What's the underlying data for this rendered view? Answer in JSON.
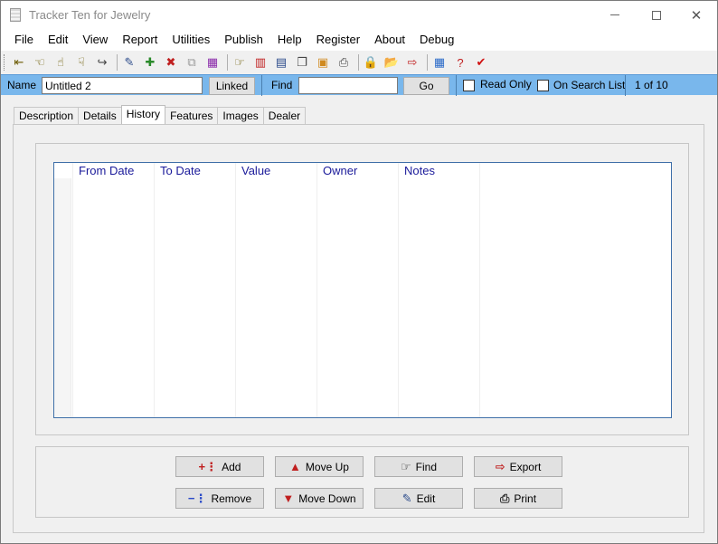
{
  "window": {
    "title": "Tracker Ten for Jewelry"
  },
  "menu": [
    "File",
    "Edit",
    "View",
    "Report",
    "Utilities",
    "Publish",
    "Help",
    "Register",
    "About",
    "Debug"
  ],
  "toolbar_icons": [
    {
      "name": "first-record-icon",
      "glyph": "⇤",
      "color": "#6b5a00"
    },
    {
      "name": "previous-record-icon",
      "glyph": "☜",
      "color": "#6b5a00"
    },
    {
      "name": "next-record-icon",
      "glyph": "☝",
      "color": "#6b5a00"
    },
    {
      "name": "last-record-icon",
      "glyph": "☟",
      "color": "#6b5a00"
    },
    {
      "name": "jump-record-icon",
      "glyph": "↪",
      "color": "#444444"
    },
    {
      "name": "edit-record-icon",
      "glyph": "✎",
      "color": "#2a4a8a"
    },
    {
      "name": "new-record-icon",
      "glyph": "✚",
      "color": "#2a8a2a"
    },
    {
      "name": "delete-record-icon",
      "glyph": "✖",
      "color": "#c02020"
    },
    {
      "name": "copy-record-icon",
      "glyph": "⧉",
      "color": "#9a9a9a"
    },
    {
      "name": "fields-icon",
      "glyph": "▦",
      "color": "#8a2aaa"
    },
    {
      "name": "search-icon",
      "glyph": "☞",
      "color": "#6b5a00"
    },
    {
      "name": "chart-icon",
      "glyph": "▥",
      "color": "#c02020"
    },
    {
      "name": "table-icon",
      "glyph": "▤",
      "color": "#2a4a8a"
    },
    {
      "name": "report-icon",
      "glyph": "❐",
      "color": "#444444"
    },
    {
      "name": "image-icon",
      "glyph": "▣",
      "color": "#d08a20"
    },
    {
      "name": "print-icon",
      "glyph": "⎙",
      "color": "#444444"
    },
    {
      "name": "lock-icon",
      "glyph": "🔒",
      "color": "#555555"
    },
    {
      "name": "open-folder-icon",
      "glyph": "📂",
      "color": "#c8a020"
    },
    {
      "name": "export-icon",
      "glyph": "⇨",
      "color": "#c02020"
    },
    {
      "name": "calculator-icon",
      "glyph": "▦",
      "color": "#2a6ac8"
    },
    {
      "name": "help-icon",
      "glyph": "?",
      "color": "#c02020"
    },
    {
      "name": "checkmark-icon",
      "glyph": "✔",
      "color": "#d01010"
    }
  ],
  "name_bar": {
    "name_label": "Name",
    "name_value": "Untitled 2",
    "linked_label": "Linked",
    "find_label": "Find",
    "find_value": "",
    "go_label": "Go",
    "read_only_label": "Read Only",
    "search_list_label": "On Search List",
    "record_counter": "1 of 10"
  },
  "tabs": [
    {
      "label": "Description",
      "active": false
    },
    {
      "label": "Details",
      "active": false
    },
    {
      "label": "History",
      "active": true
    },
    {
      "label": "Features",
      "active": false
    },
    {
      "label": "Images",
      "active": false
    },
    {
      "label": "Dealer",
      "active": false
    }
  ],
  "history_grid": {
    "columns": [
      "From Date",
      "To Date",
      "Value",
      "Owner",
      "Notes"
    ],
    "rows": []
  },
  "actions": {
    "add": "Add",
    "remove": "Remove",
    "move_up": "Move Up",
    "move_down": "Move Down",
    "find": "Find",
    "edit": "Edit",
    "export": "Export",
    "print": "Print"
  },
  "colors": {
    "name_bar": "#79b7ec",
    "grid_header_text": "#1a1a9a",
    "grid_border": "#3e6fa8"
  }
}
